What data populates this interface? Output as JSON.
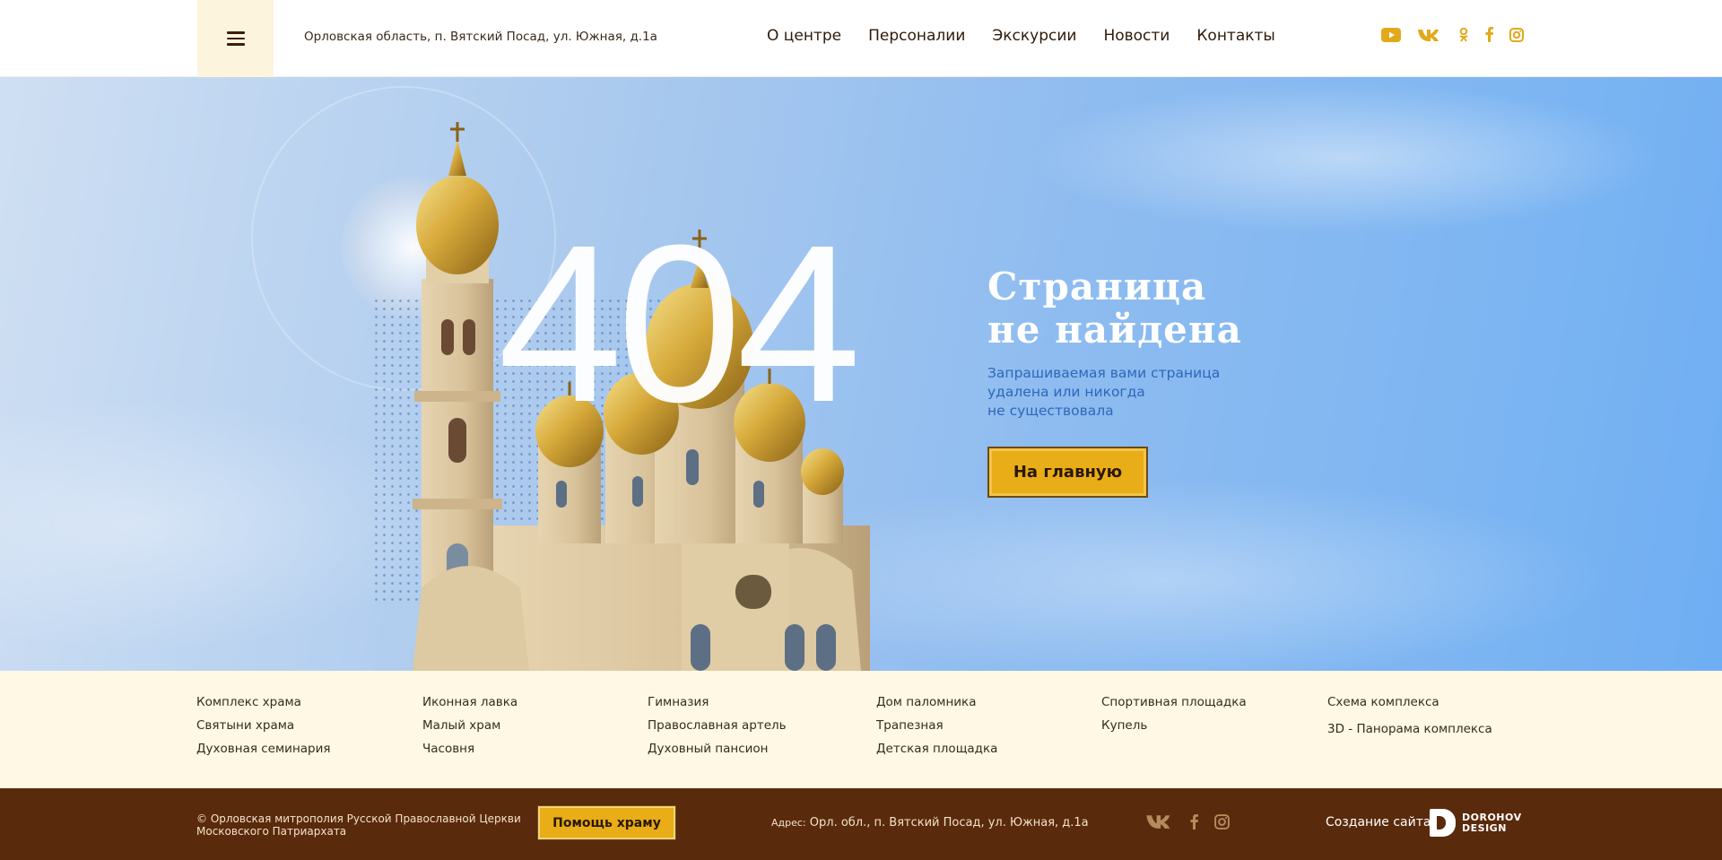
{
  "header": {
    "address": "Орловская область, п. Вятский Посад, ул. Южная, д.1а",
    "nav": [
      "О центре",
      "Персоналии",
      "Экскурсии",
      "Новости",
      "Контакты"
    ],
    "socials": [
      "youtube-icon",
      "vk-icon",
      "odnoklassniki-icon",
      "facebook-icon",
      "instagram-icon"
    ]
  },
  "hero": {
    "code": "404",
    "title_line1": "Страница",
    "title_line2": "не найдена",
    "desc_line1": "Запрашиваемая вами страница",
    "desc_line2": "удалена или никогда",
    "desc_line3": "не существовала",
    "button": "На главную"
  },
  "links": {
    "col1": [
      "Комплекс храма",
      "Святыни храма",
      "Духовная семинария"
    ],
    "col2": [
      "Иконная лавка",
      "Малый храм",
      "Часовня"
    ],
    "col3": [
      "Гимназия",
      "Православная артель",
      "Духовный пансион"
    ],
    "col4": [
      "Дом паломника",
      "Трапезная",
      "Детская площадка"
    ],
    "col5": [
      "Спортивная площадка",
      "Купель"
    ],
    "col6": [
      "Схема комплекса",
      "3D - Панорама комплекса"
    ]
  },
  "footer": {
    "copy_line1": "© Орловская митрополия Русской Православной Церкви",
    "copy_line2": "Московского Патриархата",
    "help_button": "Помощь храму",
    "address_label": "Адрес:",
    "address": "Орл. обл.,  п. Вятский Посад, ул. Южная, д.1а",
    "made_by": "Создание сайта -",
    "logo_line1": "DOROHOV",
    "logo_line2": "DESIGN"
  },
  "colors": {
    "accent": "#e8ad17",
    "footer_bg": "#5a2a0c",
    "links_bg": "#fef8e5",
    "desc": "#2e67b9"
  }
}
